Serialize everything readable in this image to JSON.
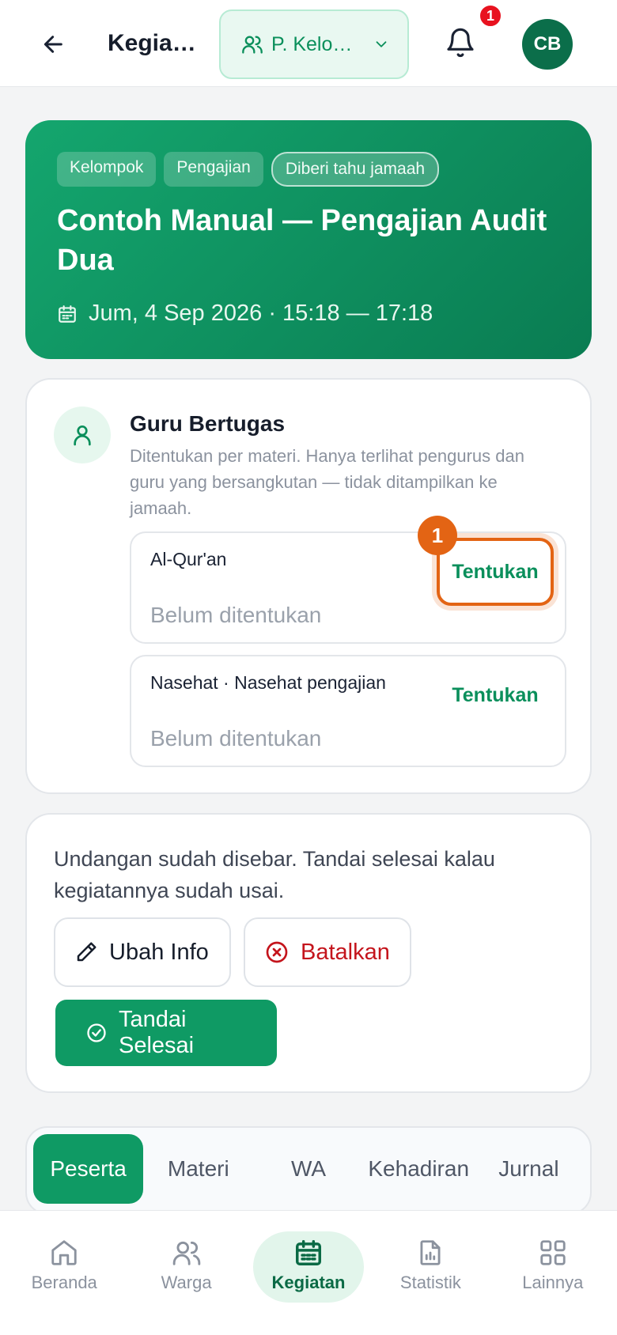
{
  "header": {
    "title": "Kegiat…",
    "group_select": "P. Kelo…",
    "notification_count": "1",
    "avatar_initials": "CB"
  },
  "hero": {
    "chips": [
      "Kelompok",
      "Pengajian",
      "Diberi tahu jamaah"
    ],
    "title": "Contoh Manual — Pengajian Audit Dua",
    "date": "Jum, 4 Sep 2026 · 15:18 — 17:18"
  },
  "guru": {
    "title": "Guru Bertugas",
    "description": "Ditentukan per materi. Hanya terlihat pengurus dan guru yang bersangkutan — tidak ditampilkan ke jamaah.",
    "slots": [
      {
        "name": "Al-Qur'an",
        "status": "Belum ditentukan",
        "action": "Tentukan"
      },
      {
        "name": "Nasehat · Nasehat pengajian",
        "status": "Belum ditentukan",
        "action": "Tentukan"
      }
    ],
    "step_badge": "1"
  },
  "actions": {
    "notice": "Undangan sudah disebar. Tandai selesai kalau kegiatannya sudah usai.",
    "edit_label": "Ubah Info",
    "cancel_label": "Batalkan",
    "done_label": "Tandai Selesai"
  },
  "tabs": [
    "Peserta",
    "Materi",
    "WA",
    "Kehadiran",
    "Jurnal"
  ],
  "bottom_nav": [
    "Beranda",
    "Warga",
    "Kegiatan",
    "Statistik",
    "Lainnya"
  ],
  "colors": {
    "primary": "#0f9a64",
    "danger": "#c4141c",
    "highlight": "#e36414"
  }
}
